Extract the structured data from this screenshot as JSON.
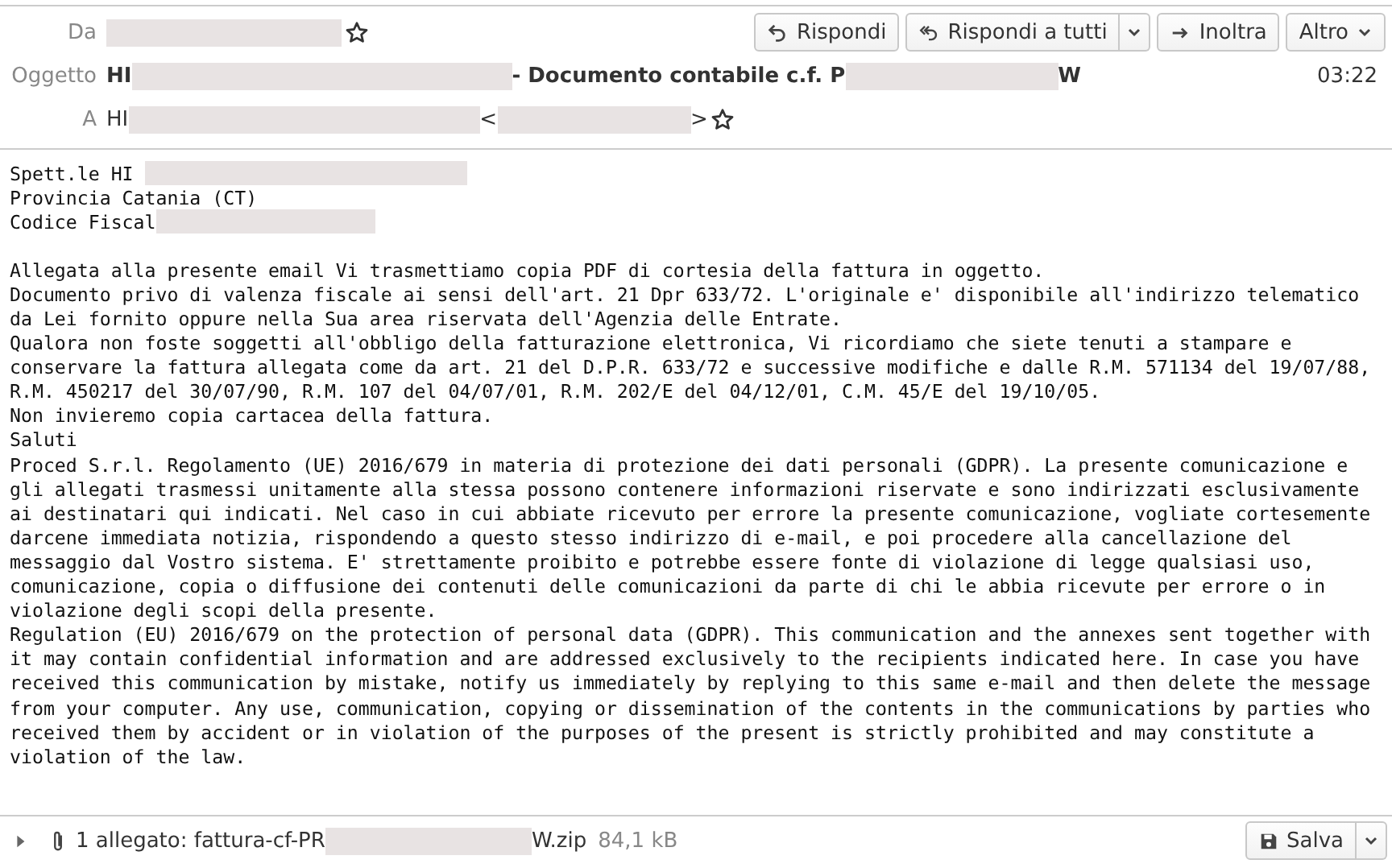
{
  "toolbar": {
    "buttons": [
      {
        "label": "Rispondi",
        "kind": "reply"
      },
      {
        "label": "Rispondi a tutti",
        "kind": "reply-all"
      },
      {
        "label": "Inoltra",
        "kind": "forward"
      },
      {
        "label": "Altro",
        "kind": "menu"
      }
    ]
  },
  "header": {
    "from": {
      "label": "Da",
      "parts": [
        {
          "kind": "redacted"
        }
      ],
      "starred": false
    },
    "subject": {
      "label": "Oggetto",
      "parts": [
        {
          "kind": "text",
          "text": "HI"
        },
        {
          "kind": "redacted"
        },
        {
          "kind": "text",
          "text": "- Documento contabile c.f. P"
        },
        {
          "kind": "redacted"
        },
        {
          "kind": "text",
          "text": "W"
        }
      ],
      "time": "03:22"
    },
    "to": {
      "label": "A",
      "parts": [
        {
          "kind": "text",
          "text": "HI"
        },
        {
          "kind": "redacted"
        },
        {
          "kind": "text",
          "text": "<"
        },
        {
          "kind": "redacted"
        },
        {
          "kind": "text",
          "text": ">"
        }
      ],
      "starred": false
    }
  },
  "body": {
    "blocks": [
      {
        "lines": [
          {
            "kind": "redacted",
            "text": "Spett.le HI "
          },
          {
            "kind": "plain",
            "text": "Provincia Catania (CT)"
          },
          {
            "kind": "redacted",
            "text": "Codice Fiscal"
          }
        ]
      },
      {
        "lines": [
          {
            "kind": "plain",
            "text": "Allegata alla presente email Vi trasmettiamo copia PDF di cortesia della fattura in oggetto."
          },
          {
            "kind": "plain",
            "text": "Documento privo di valenza fiscale ai sensi dell'art. 21 Dpr 633/72. L'originale e' disponibile all'indirizzo telematico"
          },
          {
            "kind": "plain",
            "text": "da Lei fornito oppure nella Sua area riservata dell'Agenzia delle Entrate."
          },
          {
            "kind": "plain",
            "text": "Qualora non foste soggetti all'obbligo della fatturazione elettronica, Vi ricordiamo che siete tenuti a stampare e"
          },
          {
            "kind": "plain",
            "text": "conservare la fattura allegata come da art. 21 del D.P.R. 633/72 e successive modifiche e dalle R.M. 571134 del 19/07/88,"
          },
          {
            "kind": "plain",
            "text": "R.M. 450217 del 30/07/90, R.M. 107 del 04/07/01, R.M. 202/E del 04/12/01, C.M. 45/E del 19/10/05."
          },
          {
            "kind": "plain",
            "text": "Non invieremo copia cartacea della fattura."
          },
          {
            "kind": "plain",
            "text": "Saluti"
          },
          {
            "kind": "plain",
            "text": "Proced S.r.l. Regolamento (UE) 2016/679 in materia di protezione dei dati personali (GDPR). La presente comunicazione e"
          },
          {
            "kind": "plain",
            "text": "gli allegati trasmessi unitamente alla stessa possono contenere informazioni riservate e sono indirizzati esclusivamente"
          },
          {
            "kind": "plain",
            "text": "ai destinatari qui indicati. Nel caso in cui abbiate ricevuto per errore la presente comunicazione, vogliate cortesemente"
          },
          {
            "kind": "plain",
            "text": "darcene immediata notizia, rispondendo a questo stesso indirizzo di e-mail, e poi procedere alla cancellazione del"
          },
          {
            "kind": "plain",
            "text": "messaggio dal Vostro sistema. E' strettamente proibito e potrebbe essere fonte di violazione di legge qualsiasi uso,"
          },
          {
            "kind": "plain",
            "text": "comunicazione, copia o diffusione dei contenuti delle comunicazioni da parte di chi le abbia ricevute per errore o in"
          },
          {
            "kind": "plain",
            "text": "violazione degli scopi della presente."
          },
          {
            "kind": "plain",
            "text": "Regulation (EU) 2016/679 on the protection of personal data (GDPR). This communication and the annexes sent together with"
          },
          {
            "kind": "plain",
            "text": "it may contain confidential information and are addressed exclusively to the recipients indicated here. In case you have"
          },
          {
            "kind": "plain",
            "text": "received this communication by mistake, notify us immediately by replying to this same e-mail and then delete the message"
          },
          {
            "kind": "plain",
            "text": "from your computer. Any use, communication, copying or dissemination of the contents in the communications by parties who"
          },
          {
            "kind": "plain",
            "text": "received them by accident or in violation of the purposes of the present is strictly prohibited and may constitute a"
          },
          {
            "kind": "plain",
            "text": "violation of the law."
          }
        ]
      }
    ]
  },
  "attachments": {
    "expanded": false,
    "parts": [
      {
        "kind": "text",
        "text": "1 allegato: fattura-cf-PR"
      },
      {
        "kind": "redacted"
      },
      {
        "kind": "text",
        "text": "W.zip"
      }
    ],
    "size": "84,1 kB",
    "save": {
      "label": "Salva"
    }
  }
}
